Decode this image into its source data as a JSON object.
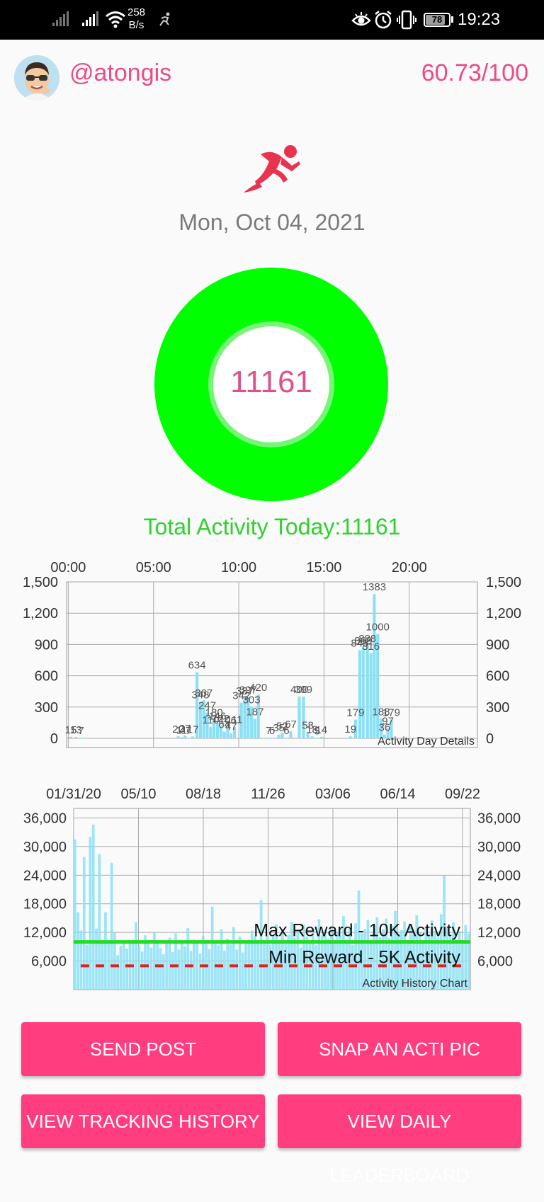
{
  "status_bar": {
    "net_speed_value": "258",
    "net_speed_unit": "B/s",
    "battery": "78",
    "time": "19:23",
    "icons": [
      "signal-icon",
      "signal-icon",
      "wifi-icon",
      "runner-icon",
      "eye-icon",
      "alarm-icon",
      "vibrate-icon",
      "battery-icon"
    ]
  },
  "header": {
    "username": "@atongis",
    "score": "60.73/100"
  },
  "date": "Mon, Oct 04, 2021",
  "ring": {
    "value": "11161",
    "color": "#00ff00"
  },
  "total_label": "Total Activity Today:11161",
  "chart_data": [
    {
      "type": "bar",
      "title": "Activity Day Details",
      "x_ticks": [
        "00:00",
        "05:00",
        "10:00",
        "15:00",
        "20:00"
      ],
      "y_ticks": [
        "0",
        "300",
        "600",
        "900",
        "1,200",
        "1,500"
      ],
      "ylim": [
        0,
        1500
      ],
      "xlim": [
        -0.1,
        24
      ],
      "grid": true,
      "legend": "none",
      "color": "#8ae0f5",
      "points": [
        {
          "t": 0.15,
          "v": 15,
          "label": "15"
        },
        {
          "t": 0.45,
          "v": 13,
          "label": "13"
        },
        {
          "t": 0.75,
          "v": 7,
          "label": "7"
        },
        {
          "t": 6.45,
          "v": 20,
          "label": "20"
        },
        {
          "t": 6.65,
          "v": 11,
          "label": "11"
        },
        {
          "t": 6.85,
          "v": 27,
          "label": "27"
        },
        {
          "t": 7.05,
          "v": 7,
          "label": "7"
        },
        {
          "t": 7.3,
          "v": 17,
          "label": "17"
        },
        {
          "t": 7.55,
          "v": 634,
          "label": "634"
        },
        {
          "t": 7.75,
          "v": 348,
          "label": "348"
        },
        {
          "t": 7.95,
          "v": 367,
          "label": "367"
        },
        {
          "t": 8.15,
          "v": 247,
          "label": "247"
        },
        {
          "t": 8.35,
          "v": 110,
          "label": "110"
        },
        {
          "t": 8.55,
          "v": 180,
          "label": "180"
        },
        {
          "t": 8.75,
          "v": 146,
          "label": "146"
        },
        {
          "t": 8.95,
          "v": 122,
          "label": "122"
        },
        {
          "t": 9.15,
          "v": 64,
          "label": "64"
        },
        {
          "t": 9.35,
          "v": 106,
          "label": "106"
        },
        {
          "t": 9.55,
          "v": 47,
          "label": "47"
        },
        {
          "t": 9.75,
          "v": 111,
          "label": "111"
        },
        {
          "t": 10.15,
          "v": 342,
          "label": "342"
        },
        {
          "t": 10.35,
          "v": 387,
          "label": "387"
        },
        {
          "t": 10.55,
          "v": 397,
          "label": "397"
        },
        {
          "t": 10.75,
          "v": 303,
          "label": "303"
        },
        {
          "t": 10.95,
          "v": 187,
          "label": "187"
        },
        {
          "t": 11.15,
          "v": 420,
          "label": "420"
        },
        {
          "t": 11.75,
          "v": 7,
          "label": "7"
        },
        {
          "t": 11.95,
          "v": 6,
          "label": "6"
        },
        {
          "t": 12.35,
          "v": 35,
          "label": "35"
        },
        {
          "t": 12.55,
          "v": 52,
          "label": "52"
        },
        {
          "t": 12.8,
          "v": 6,
          "label": "6"
        },
        {
          "t": 13.05,
          "v": 67,
          "label": "67"
        },
        {
          "t": 13.55,
          "v": 400,
          "label": "400"
        },
        {
          "t": 13.8,
          "v": 399,
          "label": "399"
        },
        {
          "t": 14.05,
          "v": 58,
          "label": "58"
        },
        {
          "t": 14.3,
          "v": 18,
          "label": "18"
        },
        {
          "t": 14.6,
          "v": 5,
          "label": "5"
        },
        {
          "t": 14.85,
          "v": 14,
          "label": "14"
        },
        {
          "t": 16.55,
          "v": 19,
          "label": "19"
        },
        {
          "t": 16.85,
          "v": 179,
          "label": "179"
        },
        {
          "t": 17.1,
          "v": 845,
          "label": "845"
        },
        {
          "t": 17.3,
          "v": 868,
          "label": "868"
        },
        {
          "t": 17.55,
          "v": 888,
          "label": "888"
        },
        {
          "t": 17.75,
          "v": 816,
          "label": "816"
        },
        {
          "t": 17.95,
          "v": 1383,
          "label": "1383"
        },
        {
          "t": 18.15,
          "v": 1000,
          "label": "1000"
        },
        {
          "t": 18.35,
          "v": 188,
          "label": "188"
        },
        {
          "t": 18.55,
          "v": 36,
          "label": "36"
        },
        {
          "t": 18.75,
          "v": 97,
          "label": "97"
        },
        {
          "t": 18.95,
          "v": 179,
          "label": "179"
        }
      ]
    },
    {
      "type": "bar",
      "title": "Activity History Chart",
      "x_ticks": [
        "01/31/20",
        "05/10",
        "08/18",
        "11/26",
        "03/06",
        "06/14",
        "09/22"
      ],
      "y_ticks": [
        "6,000",
        "12,000",
        "18,000",
        "24,000",
        "30,000",
        "36,000"
      ],
      "ylim": [
        0,
        38000
      ],
      "grid": true,
      "legend": "none",
      "color": "#8ae0f5",
      "x_start": "2020-01-31",
      "x_end": "2021-10-04",
      "lines": [
        {
          "label": "Max Reward - 10K Activity",
          "value": 10000,
          "color": "#22dd22",
          "style": "solid"
        },
        {
          "label": "Min Reward - 5K Activity",
          "value": 5000,
          "color": "#dd2222",
          "style": "dashed"
        }
      ],
      "values": [
        31500,
        16200,
        12400,
        27800,
        9400,
        32000,
        34600,
        12800,
        28400,
        9800,
        16200,
        10200,
        26600,
        11900,
        7200,
        9200,
        10100,
        8600,
        9700,
        10500,
        14100,
        9300,
        8000,
        11400,
        10100,
        8800,
        12000,
        9700,
        8700,
        7400,
        9800,
        10900,
        7900,
        11800,
        8400,
        10300,
        9100,
        12900,
        8100,
        10500,
        9800,
        7600,
        11200,
        9900,
        8500,
        17400,
        10200,
        9300,
        12600,
        8200,
        10700,
        9500,
        13100,
        8400,
        11100,
        7800,
        9700,
        10500,
        12400,
        11300,
        9800,
        18800,
        10200,
        12200,
        9400,
        11600,
        13700,
        10300,
        12800,
        9600,
        11500,
        14200,
        10900,
        12300,
        8800,
        13600,
        11100,
        10000,
        12700,
        9300,
        14800,
        11400,
        12500,
        10700,
        13300,
        9900,
        12200,
        11300,
        15400,
        10600,
        12800,
        9400,
        13900,
        20800,
        11800,
        12700,
        14600,
        10300,
        13200,
        15200,
        11000,
        12600,
        14900,
        10800,
        13400,
        16500,
        11700,
        12500,
        14300,
        10400,
        13800,
        11900,
        15600,
        12100,
        10300,
        13000,
        11600,
        14500,
        12400,
        10900,
        15800,
        23900,
        12900,
        11100,
        14100,
        10500,
        12300,
        9600,
        13500,
        11800
      ]
    }
  ],
  "buttons": {
    "send_post": "SEND POST",
    "snap_pic": "SNAP AN ACTI PIC",
    "view_history": "VIEW TRACKING HISTORY",
    "view_leaderboard": "VIEW DAILY LEADERBOARD"
  }
}
